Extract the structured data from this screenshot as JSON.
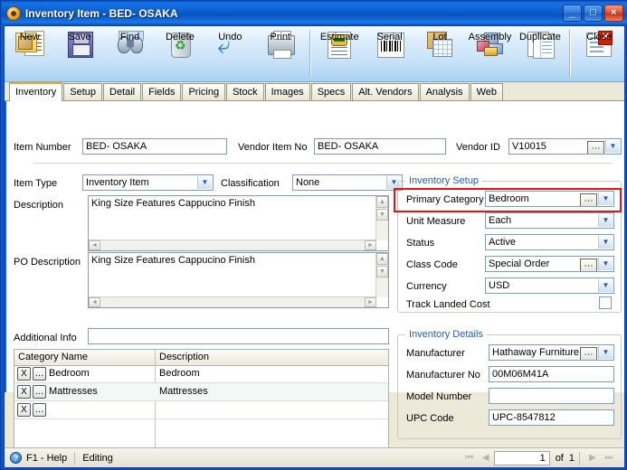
{
  "window": {
    "title": "Inventory Item - BED- OSAKA",
    "icon": "inventory-item-icon",
    "minimize": "_",
    "maximize": "□",
    "close": "×"
  },
  "toolbar": {
    "buttons": [
      {
        "label": "New",
        "icon": "new-document-icon"
      },
      {
        "label": "Save",
        "icon": "floppy-disk-icon"
      },
      {
        "label": "Find",
        "icon": "binoculars-icon"
      },
      {
        "label": "Delete",
        "icon": "recycle-bin-icon"
      },
      {
        "label": "Undo",
        "icon": "undo-arrow-icon"
      },
      {
        "label": "Print",
        "icon": "printer-icon"
      },
      {
        "label": "Estimate",
        "icon": "estimate-icon"
      },
      {
        "label": "Serial",
        "icon": "barcode-icon"
      },
      {
        "label": "Lot",
        "icon": "lot-icon"
      },
      {
        "label": "Assembly",
        "icon": "assembly-blocks-icon"
      },
      {
        "label": "Duplicate",
        "icon": "duplicate-pages-icon"
      },
      {
        "label": "Close",
        "icon": "close-document-icon"
      }
    ]
  },
  "tabs": [
    {
      "label": "Inventory",
      "active": true
    },
    {
      "label": "Setup",
      "active": false
    },
    {
      "label": "Detail",
      "active": false
    },
    {
      "label": "Fields",
      "active": false
    },
    {
      "label": "Pricing",
      "active": false
    },
    {
      "label": "Stock",
      "active": false
    },
    {
      "label": "Images",
      "active": false
    },
    {
      "label": "Specs",
      "active": false
    },
    {
      "label": "Alt. Vendors",
      "active": false
    },
    {
      "label": "Analysis",
      "active": false
    },
    {
      "label": "Web",
      "active": false
    }
  ],
  "form": {
    "item_number_label": "Item Number",
    "item_number_value": "BED- OSAKA",
    "vendor_item_no_label": "Vendor Item No",
    "vendor_item_no_value": "BED- OSAKA",
    "vendor_id_label": "Vendor ID",
    "vendor_id_value": "V10015",
    "item_type_label": "Item Type",
    "item_type_value": "Inventory Item",
    "classification_label": "Classification",
    "classification_value": "None",
    "description_label": "Description",
    "description_value": "King Size Features Cappucino Finish",
    "po_description_label": "PO Description",
    "po_description_value": "King Size Features Cappucino Finish",
    "additional_info_label": "Additional Info",
    "additional_info_value": ""
  },
  "inventory_setup": {
    "title": "Inventory Setup",
    "highlighted_field": "Primary Category",
    "fields": [
      {
        "label": "Primary Category",
        "value": "Bedroom",
        "has_ellipsis": true
      },
      {
        "label": "Unit Measure",
        "value": "Each",
        "has_ellipsis": false
      },
      {
        "label": "Status",
        "value": "Active",
        "has_ellipsis": false
      },
      {
        "label": "Class Code",
        "value": "Special Order",
        "has_ellipsis": true
      },
      {
        "label": "Currency",
        "value": "USD",
        "has_ellipsis": false
      }
    ],
    "track_landed_cost_label": "Track Landed Cost",
    "track_landed_cost_checked": false
  },
  "inventory_details": {
    "title": "Inventory Details",
    "fields": [
      {
        "label": "Manufacturer",
        "value": "Hathaway Furniture W",
        "type": "combo"
      },
      {
        "label": "Manufacturer No",
        "value": "00M06M41A",
        "type": "text"
      },
      {
        "label": "Model Number",
        "value": "",
        "type": "text"
      },
      {
        "label": "UPC Code",
        "value": "UPC-8547812",
        "type": "text"
      }
    ]
  },
  "category_grid": {
    "columns": [
      "Category Name",
      "Description"
    ],
    "rows": [
      {
        "name": "Bedroom",
        "description": "Bedroom",
        "delete": "X",
        "browse": "…"
      },
      {
        "name": "Mattresses",
        "description": "Mattresses",
        "delete": "X",
        "browse": "…"
      },
      {
        "name": "",
        "description": "",
        "delete": "X",
        "browse": "…"
      }
    ]
  },
  "statusbar": {
    "help_icon": "help-question-icon",
    "help_label": "F1 - Help",
    "mode": "Editing",
    "first_icon": "⏮",
    "prev_icon": "◀",
    "page_value": "1",
    "of_label": "of",
    "total_pages": "1",
    "next_icon": "▶",
    "last_icon": "⏭"
  },
  "colors": {
    "accent": "#1f5fbf",
    "highlight": "#ee1111",
    "title_bar": "#0a5ad4",
    "tab_active": "#f0a82a"
  }
}
